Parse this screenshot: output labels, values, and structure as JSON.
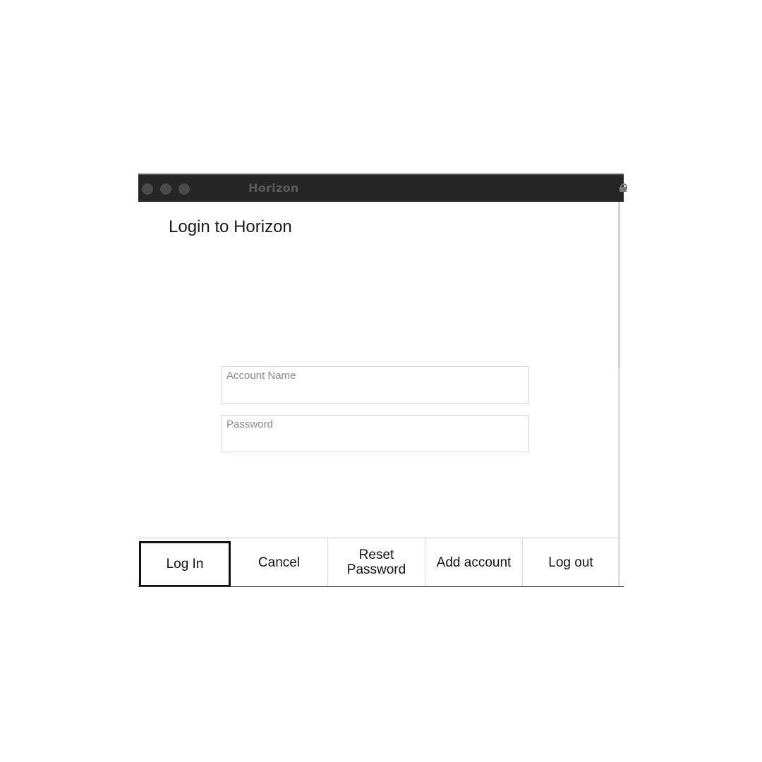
{
  "window": {
    "app_title": "Horizon",
    "heading": "Login to Horizon"
  },
  "form": {
    "account_name_placeholder": "Account Name",
    "account_name_value": "",
    "password_placeholder": "Password",
    "password_value": ""
  },
  "buttons": {
    "log_in": "Log In",
    "cancel": "Cancel",
    "reset_password": "Reset\nPassword",
    "add_account": "Add account",
    "log_out": "Log out"
  },
  "annotations": {
    "marker_fields": "3",
    "marker_login": "4"
  },
  "colors": {
    "titlebar": "#262626",
    "marker": "#000000"
  },
  "icons": {
    "lock": "lock-icon",
    "window_controls": [
      "close-dot",
      "minimize-dot",
      "zoom-dot"
    ]
  }
}
